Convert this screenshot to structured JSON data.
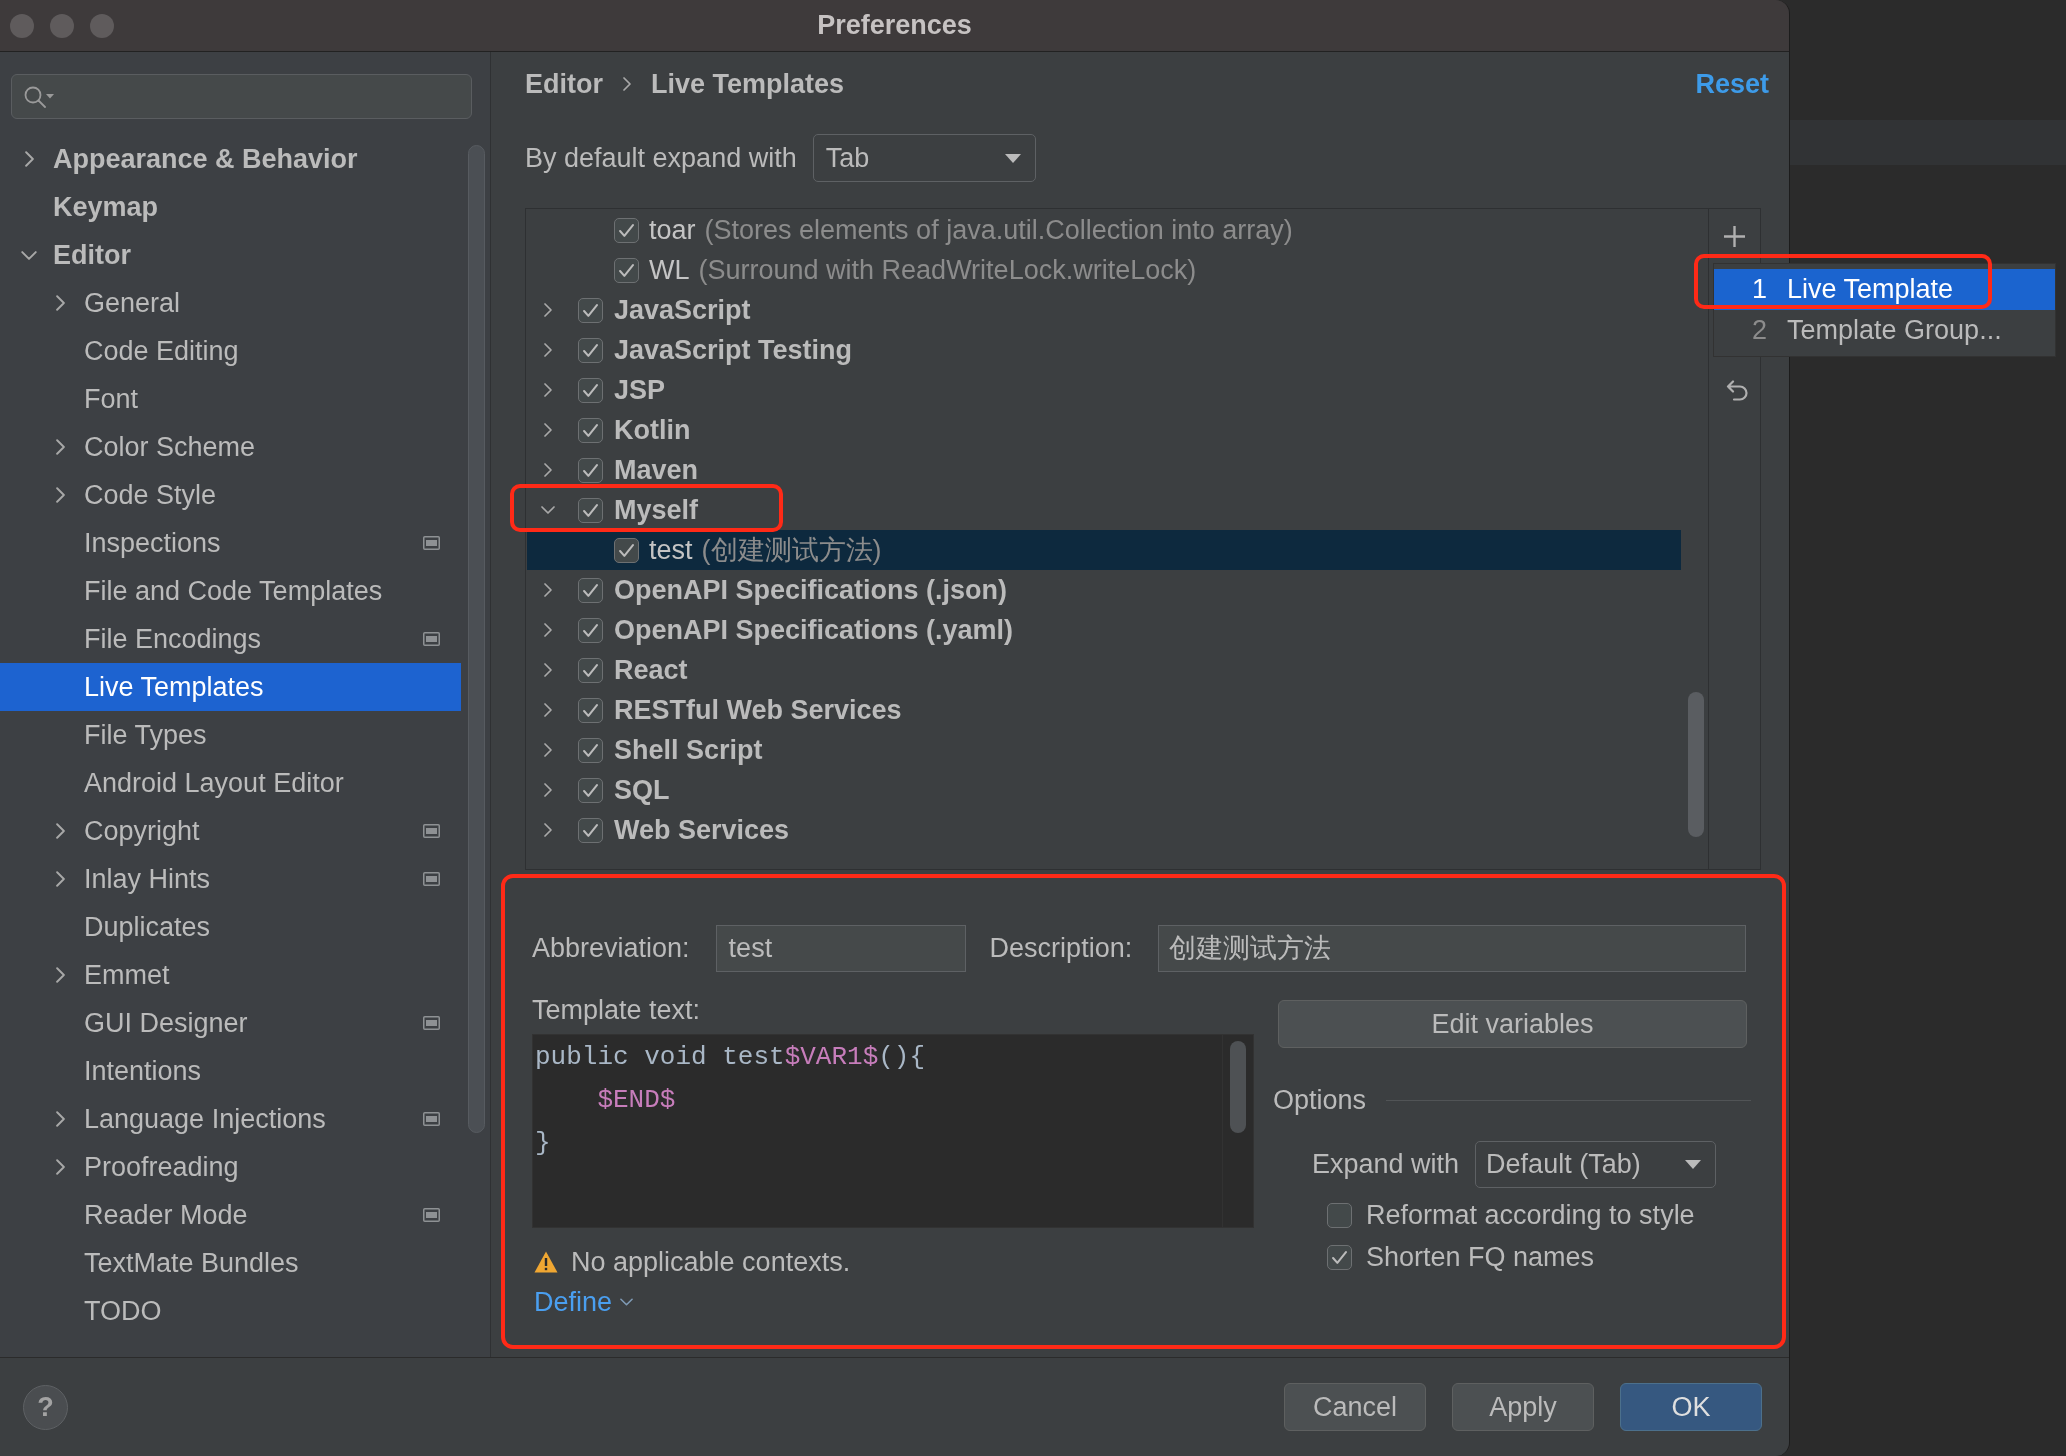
{
  "window": {
    "title": "Preferences"
  },
  "sidebar": {
    "items": [
      {
        "label": "Appearance & Behavior",
        "kind": "branch",
        "expanded": false,
        "project_badge": false,
        "selected": false
      },
      {
        "label": "Keymap",
        "kind": "leaf",
        "project_badge": false,
        "selected": false
      },
      {
        "label": "Editor",
        "kind": "branch",
        "expanded": true,
        "project_badge": false,
        "selected": false,
        "children": [
          {
            "label": "General",
            "kind": "branch",
            "expanded": false,
            "project_badge": false,
            "selected": false
          },
          {
            "label": "Code Editing",
            "kind": "leaf",
            "project_badge": false,
            "selected": false
          },
          {
            "label": "Font",
            "kind": "leaf",
            "project_badge": false,
            "selected": false
          },
          {
            "label": "Color Scheme",
            "kind": "branch",
            "expanded": false,
            "project_badge": false,
            "selected": false
          },
          {
            "label": "Code Style",
            "kind": "branch",
            "expanded": false,
            "project_badge": false,
            "selected": false
          },
          {
            "label": "Inspections",
            "kind": "leaf",
            "project_badge": true,
            "selected": false
          },
          {
            "label": "File and Code Templates",
            "kind": "leaf",
            "project_badge": false,
            "selected": false
          },
          {
            "label": "File Encodings",
            "kind": "leaf",
            "project_badge": true,
            "selected": false
          },
          {
            "label": "Live Templates",
            "kind": "leaf",
            "project_badge": false,
            "selected": true
          },
          {
            "label": "File Types",
            "kind": "leaf",
            "project_badge": false,
            "selected": false
          },
          {
            "label": "Android Layout Editor",
            "kind": "leaf",
            "project_badge": false,
            "selected": false
          },
          {
            "label": "Copyright",
            "kind": "branch",
            "expanded": false,
            "project_badge": true,
            "selected": false
          },
          {
            "label": "Inlay Hints",
            "kind": "branch",
            "expanded": false,
            "project_badge": true,
            "selected": false
          },
          {
            "label": "Duplicates",
            "kind": "leaf",
            "project_badge": false,
            "selected": false
          },
          {
            "label": "Emmet",
            "kind": "branch",
            "expanded": false,
            "project_badge": false,
            "selected": false
          },
          {
            "label": "GUI Designer",
            "kind": "leaf",
            "project_badge": true,
            "selected": false
          },
          {
            "label": "Intentions",
            "kind": "leaf",
            "project_badge": false,
            "selected": false
          },
          {
            "label": "Language Injections",
            "kind": "branch",
            "expanded": false,
            "project_badge": true,
            "selected": false
          },
          {
            "label": "Proofreading",
            "kind": "branch",
            "expanded": false,
            "project_badge": false,
            "selected": false
          },
          {
            "label": "Reader Mode",
            "kind": "leaf",
            "project_badge": true,
            "selected": false
          },
          {
            "label": "TextMate Bundles",
            "kind": "leaf",
            "project_badge": false,
            "selected": false
          },
          {
            "label": "TODO",
            "kind": "leaf",
            "project_badge": false,
            "selected": false
          }
        ]
      }
    ]
  },
  "breadcrumb": [
    "Editor",
    "Live Templates"
  ],
  "reset_link": "Reset",
  "expand_setting": {
    "label": "By default expand with",
    "value": "Tab"
  },
  "tree": {
    "items": [
      {
        "kind": "template",
        "name": "toar",
        "description": "(Stores elements of java.util.Collection into array)",
        "checked": true,
        "selected": false
      },
      {
        "kind": "template",
        "name": "WL",
        "description": "(Surround with ReadWriteLock.writeLock)",
        "checked": true,
        "selected": false
      },
      {
        "kind": "group",
        "name": "JavaScript",
        "checked": true,
        "expanded": false,
        "selected": false,
        "highlighted": false
      },
      {
        "kind": "group",
        "name": "JavaScript Testing",
        "checked": true,
        "expanded": false,
        "selected": false,
        "highlighted": false
      },
      {
        "kind": "group",
        "name": "JSP",
        "checked": true,
        "expanded": false,
        "selected": false,
        "highlighted": false
      },
      {
        "kind": "group",
        "name": "Kotlin",
        "checked": true,
        "expanded": false,
        "selected": false,
        "highlighted": false
      },
      {
        "kind": "group",
        "name": "Maven",
        "checked": true,
        "expanded": false,
        "selected": false,
        "highlighted": false
      },
      {
        "kind": "group",
        "name": "Myself",
        "checked": true,
        "expanded": true,
        "selected": false,
        "highlighted": true,
        "children": [
          {
            "kind": "template",
            "name": "test",
            "description": "(创建测试方法)",
            "checked": true,
            "selected": true
          }
        ]
      },
      {
        "kind": "group",
        "name": "OpenAPI Specifications (.json)",
        "checked": true,
        "expanded": false,
        "selected": false,
        "highlighted": false
      },
      {
        "kind": "group",
        "name": "OpenAPI Specifications (.yaml)",
        "checked": true,
        "expanded": false,
        "selected": false,
        "highlighted": false
      },
      {
        "kind": "group",
        "name": "React",
        "checked": true,
        "expanded": false,
        "selected": false,
        "highlighted": false
      },
      {
        "kind": "group",
        "name": "RESTful Web Services",
        "checked": true,
        "expanded": false,
        "selected": false,
        "highlighted": false
      },
      {
        "kind": "group",
        "name": "Shell Script",
        "checked": true,
        "expanded": false,
        "selected": false,
        "highlighted": false
      },
      {
        "kind": "group",
        "name": "SQL",
        "checked": true,
        "expanded": false,
        "selected": false,
        "highlighted": false
      },
      {
        "kind": "group",
        "name": "Web Services",
        "checked": true,
        "expanded": false,
        "selected": false,
        "highlighted": false
      }
    ]
  },
  "add_menu": {
    "items": [
      {
        "number": "1",
        "label": "Live Template",
        "selected": true,
        "highlighted": true
      },
      {
        "number": "2",
        "label": "Template Group...",
        "selected": false,
        "highlighted": false
      }
    ]
  },
  "template_editor": {
    "highlighted": true,
    "abbreviation": {
      "label": "Abbreviation:",
      "value": "test"
    },
    "description": {
      "label": "Description:",
      "value": "创建测试方法"
    },
    "template_text": {
      "label": "Template text:",
      "lines": [
        [
          {
            "kind": "plain",
            "text": "public void test"
          },
          {
            "kind": "variable",
            "text": "$VAR1$"
          },
          {
            "kind": "plain",
            "text": "(){"
          }
        ],
        [
          {
            "kind": "variable",
            "text": "    $END$"
          }
        ],
        [
          {
            "kind": "plain",
            "text": "}"
          }
        ]
      ]
    },
    "warning": "No applicable contexts.",
    "define_link": "Define",
    "edit_variables_button": "Edit variables",
    "options": {
      "title": "Options",
      "expand_with": {
        "label": "Expand with",
        "value": "Default (Tab)"
      },
      "checkboxes": [
        {
          "label": "Reformat according to style",
          "checked": false
        },
        {
          "label": "Shorten FQ names",
          "checked": true
        }
      ]
    }
  },
  "help_button": "?",
  "buttons": [
    {
      "label": "Cancel",
      "primary": false
    },
    {
      "label": "Apply",
      "primary": false
    },
    {
      "label": "OK",
      "primary": true
    }
  ]
}
